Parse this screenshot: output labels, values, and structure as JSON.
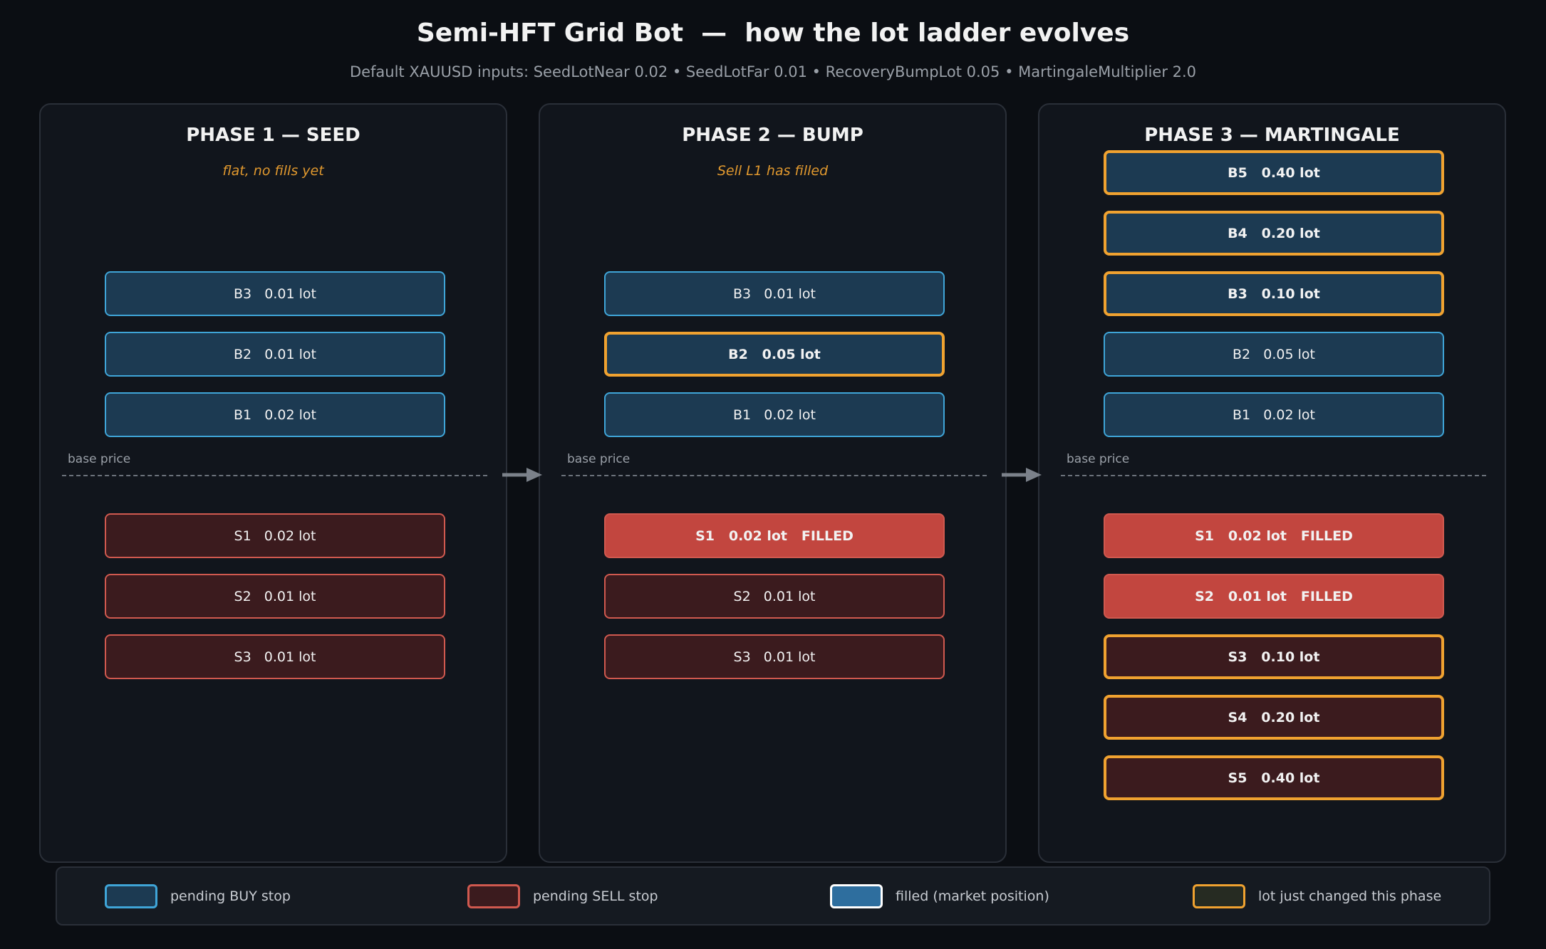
{
  "title": "Semi-HFT Grid Bot  —  how the lot ladder evolves",
  "subtitle": "Default XAUUSD inputs: SeedLotNear 0.02  •  SeedLotFar 0.01  •  RecoveryBumpLot 0.05  •  MartingaleMultiplier 2.0",
  "base_label": "base price",
  "colors": {
    "buy_fill": "#1c3a52",
    "buy_border": "#3fa5d8",
    "sell_fill": "#3b1b1e",
    "sell_border": "#d0594f",
    "filled_fill": "#c2463f",
    "market_fill": "#2e6e9e",
    "changed_border": "#f0a230"
  },
  "phases": [
    {
      "title": "PHASE 1 — SEED",
      "subtitle": "flat, no fills yet",
      "rungs": [
        {
          "label": "B3   0.01 lot",
          "side": "buy",
          "level": 3,
          "state": "pending"
        },
        {
          "label": "B2   0.01 lot",
          "side": "buy",
          "level": 2,
          "state": "pending"
        },
        {
          "label": "B1   0.02 lot",
          "side": "buy",
          "level": 1,
          "state": "pending"
        },
        {
          "label": "S1   0.02 lot",
          "side": "sell",
          "level": 1,
          "state": "pending"
        },
        {
          "label": "S2   0.01 lot",
          "side": "sell",
          "level": 2,
          "state": "pending"
        },
        {
          "label": "S3   0.01 lot",
          "side": "sell",
          "level": 3,
          "state": "pending"
        }
      ]
    },
    {
      "title": "PHASE 2 — BUMP",
      "subtitle": "Sell L1 has filled",
      "rungs": [
        {
          "label": "B3   0.01 lot",
          "side": "buy",
          "level": 3,
          "state": "pending"
        },
        {
          "label": "B2   0.05 lot",
          "side": "buy",
          "level": 2,
          "state": "changed"
        },
        {
          "label": "B1   0.02 lot",
          "side": "buy",
          "level": 1,
          "state": "pending"
        },
        {
          "label": "S1   0.02 lot   FILLED",
          "side": "sell",
          "level": 1,
          "state": "filled"
        },
        {
          "label": "S2   0.01 lot",
          "side": "sell",
          "level": 2,
          "state": "pending"
        },
        {
          "label": "S3   0.01 lot",
          "side": "sell",
          "level": 3,
          "state": "pending"
        }
      ]
    },
    {
      "title": "PHASE 3 — MARTINGALE",
      "subtitle": "",
      "rungs": [
        {
          "label": "B5   0.40 lot",
          "side": "buy",
          "level": 5,
          "state": "changed"
        },
        {
          "label": "B4   0.20 lot",
          "side": "buy",
          "level": 4,
          "state": "changed"
        },
        {
          "label": "B3   0.10 lot",
          "side": "buy",
          "level": 3,
          "state": "changed"
        },
        {
          "label": "B2   0.05 lot",
          "side": "buy",
          "level": 2,
          "state": "pending"
        },
        {
          "label": "B1   0.02 lot",
          "side": "buy",
          "level": 1,
          "state": "pending"
        },
        {
          "label": "S1   0.02 lot   FILLED",
          "side": "sell",
          "level": 1,
          "state": "filled"
        },
        {
          "label": "S2   0.01 lot   FILLED",
          "side": "sell",
          "level": 2,
          "state": "filled"
        },
        {
          "label": "S3   0.10 lot",
          "side": "sell",
          "level": 3,
          "state": "changed"
        },
        {
          "label": "S4   0.20 lot",
          "side": "sell",
          "level": 4,
          "state": "changed"
        },
        {
          "label": "S5   0.40 lot",
          "side": "sell",
          "level": 5,
          "state": "changed"
        }
      ]
    }
  ],
  "legend": [
    {
      "label": "pending BUY stop",
      "kind": "buy"
    },
    {
      "label": "pending SELL stop",
      "kind": "sell"
    },
    {
      "label": "filled (market position)",
      "kind": "market"
    },
    {
      "label": "lot just changed this phase",
      "kind": "changed"
    }
  ]
}
